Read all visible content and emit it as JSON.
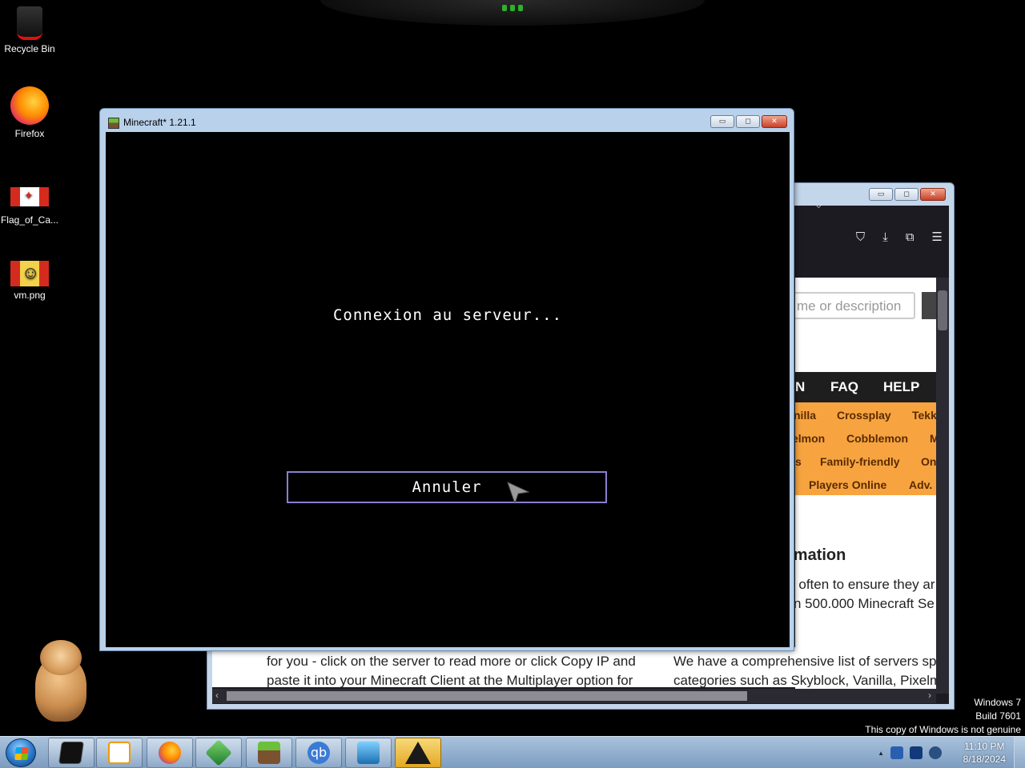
{
  "desktop": {
    "icons": [
      {
        "label": "Recycle Bin",
        "icon": "recycle-bin-icon"
      },
      {
        "label": "Firefox",
        "icon": "firefox-icon"
      },
      {
        "label": "Flag_of_Ca...",
        "icon": "image-file-icon"
      },
      {
        "label": "vm.png",
        "icon": "image-file-icon"
      }
    ]
  },
  "minecraft_window": {
    "title": "Minecraft* 1.21.1",
    "status": "Connexion au serveur...",
    "cancel_label": "Annuler",
    "buttons": {
      "minimize": "▭",
      "maximize": "◻",
      "close": "✕"
    }
  },
  "browser_window": {
    "buttons": {
      "minimize": "▭",
      "maximize": "◻",
      "close": "✕"
    },
    "toolbar_icons": [
      "pocket-icon",
      "download-icon",
      "extensions-icon",
      "menu-icon"
    ],
    "search_placeholder": "me or description",
    "nav": [
      "N",
      "FAQ",
      "HELP"
    ],
    "tags": [
      {
        "text": "nilla",
        "row": 0
      },
      {
        "text": "Crossplay",
        "row": 0
      },
      {
        "text": "Tekk",
        "row": 0
      },
      {
        "text": "elmon",
        "row": 1
      },
      {
        "text": "Cobblemon",
        "row": 1
      },
      {
        "text": "M",
        "row": 1
      },
      {
        "text": "s",
        "row": 2
      },
      {
        "text": "Family-friendly",
        "row": 2
      },
      {
        "text": "On",
        "row": 2
      },
      {
        "text": "Players Online",
        "row": 3
      },
      {
        "text": "Adv.",
        "row": 3
      }
    ],
    "info_title": "rmation",
    "info_lines": [
      "r often to ensure they ar",
      "n 500.000 Minecraft Se"
    ],
    "bottom_left": [
      "for you - click on the server to read more or click Copy IP and",
      "paste it into your Minecraft Client at the Multiplayer option for"
    ],
    "bottom_right": [
      "We have a comprehensive list of servers sp",
      "categories such as Skyblock, Vanilla, Pixelm"
    ]
  },
  "taskbar": {
    "apps": [
      {
        "name": "terminal-icon"
      },
      {
        "name": "vlc-icon"
      },
      {
        "name": "firefox-icon"
      },
      {
        "name": "emerald-icon"
      },
      {
        "name": "minecraft-icon"
      },
      {
        "name": "qbittorrent-icon",
        "glyph": "qb"
      },
      {
        "name": "kb-icon"
      },
      {
        "name": "warning-app-icon"
      }
    ],
    "clock_time": "11:10 PM",
    "clock_date": "8/18/2024",
    "tray_arrow": "▲"
  },
  "watermark": {
    "line1": "Windows 7",
    "line2": "Build 7601",
    "line3": "This copy of Windows is not genuine"
  },
  "colors": {
    "taskbar": "#7c9cbf",
    "orange_tags": "#f7a440",
    "mc_button_border": "#8a7fd0"
  }
}
